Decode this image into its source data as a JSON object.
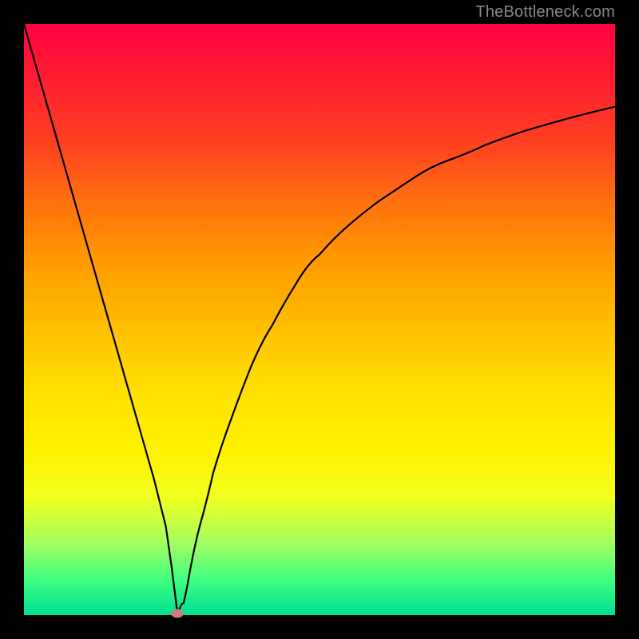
{
  "watermark": "TheBottleneck.com",
  "chart_data": {
    "type": "line",
    "title": "",
    "xlabel": "",
    "ylabel": "",
    "xlim": [
      0,
      100
    ],
    "ylim": [
      0,
      100
    ],
    "grid": false,
    "legend": false,
    "background_gradient": {
      "orientation": "vertical",
      "stops": [
        {
          "pos": 0,
          "color": "#ff0040"
        },
        {
          "pos": 50,
          "color": "#ffc000"
        },
        {
          "pos": 75,
          "color": "#ffff00"
        },
        {
          "pos": 100,
          "color": "#00e090"
        }
      ]
    },
    "series": [
      {
        "name": "bottleneck-curve",
        "color": "#000000",
        "x": [
          0,
          2,
          4,
          6,
          8,
          10,
          12,
          14,
          16,
          18,
          20,
          22,
          24,
          25,
          26,
          27,
          28,
          30,
          32,
          35,
          38,
          42,
          46,
          50,
          55,
          60,
          66,
          72,
          78,
          85,
          92,
          100
        ],
        "y": [
          100,
          93,
          86,
          79,
          72,
          65,
          58,
          51,
          44,
          37,
          30,
          23,
          15,
          8,
          0,
          2,
          7,
          16,
          24,
          33,
          41,
          49,
          56,
          61,
          66,
          70,
          74,
          77,
          79.5,
          82,
          84,
          86
        ]
      }
    ],
    "markers": [
      {
        "name": "optimal-point",
        "x": 26,
        "y": 0,
        "color": "#cd7f7f"
      }
    ]
  }
}
